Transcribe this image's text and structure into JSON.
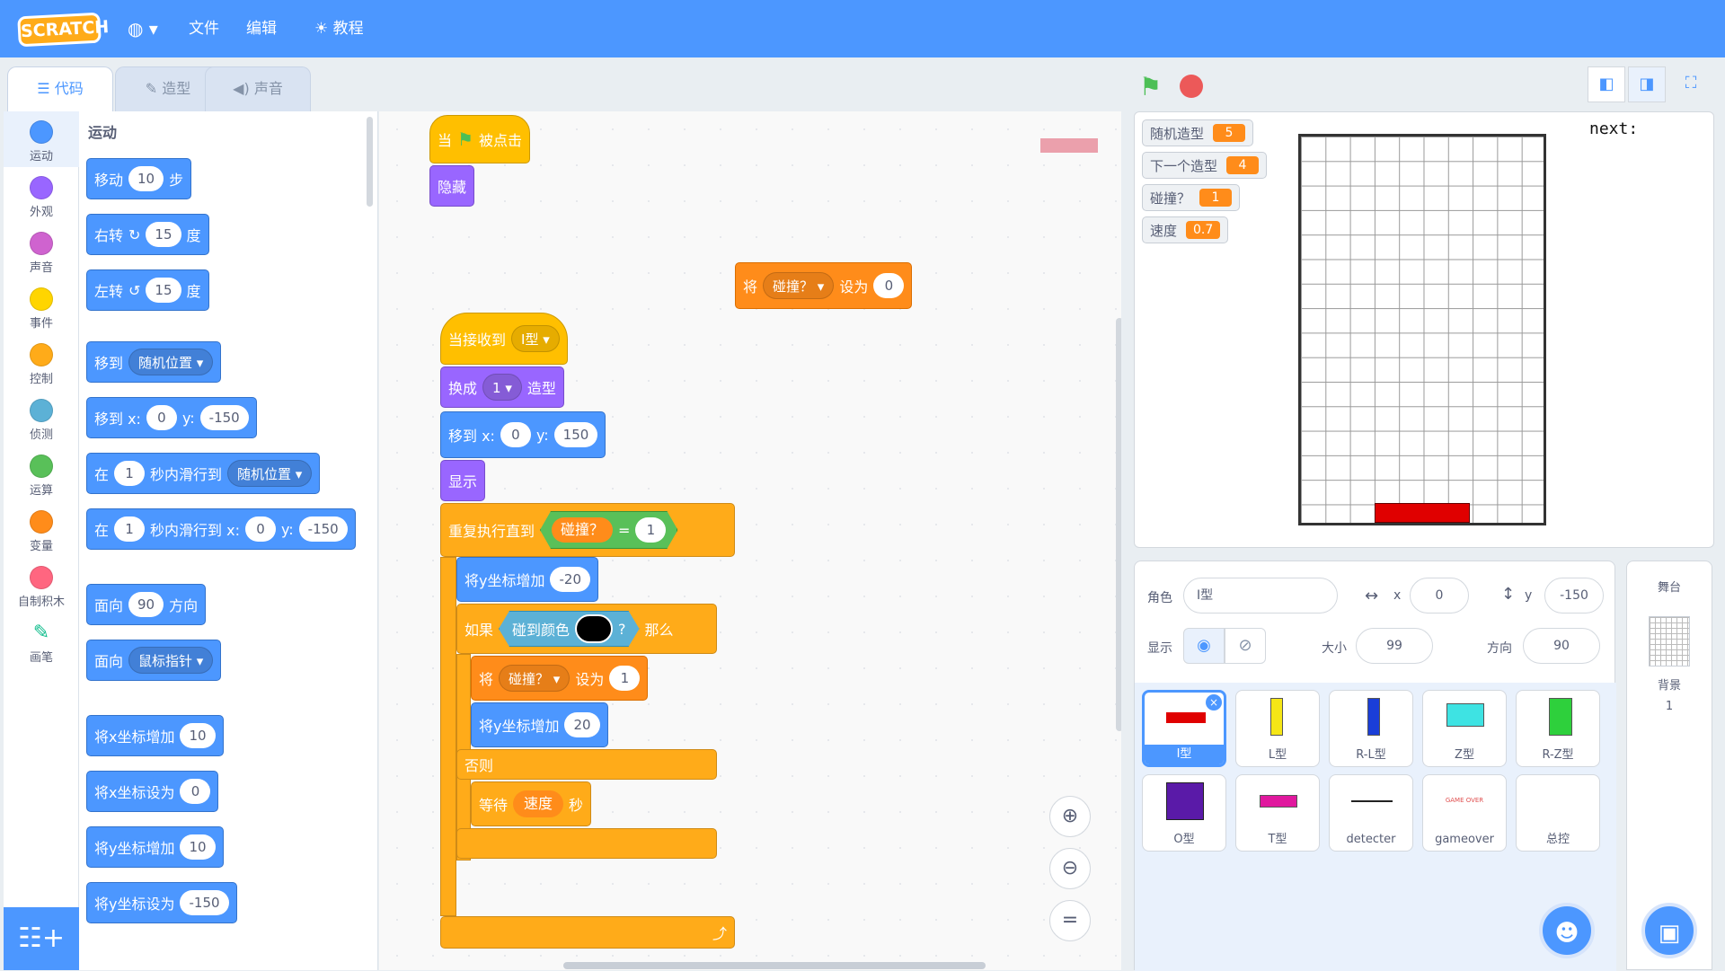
{
  "menu": {
    "logo": "SCRATCH",
    "globe": "◍ ▾",
    "file": "文件",
    "edit": "编辑",
    "tutorials": "教程"
  },
  "tabs": {
    "code": "代码",
    "costumes": "造型",
    "sounds": "声音"
  },
  "categories": [
    {
      "label": "运动",
      "color": "#4c97ff"
    },
    {
      "label": "外观",
      "color": "#9966ff"
    },
    {
      "label": "声音",
      "color": "#cf63cf"
    },
    {
      "label": "事件",
      "color": "#ffd500"
    },
    {
      "label": "控制",
      "color": "#ffab19"
    },
    {
      "label": "侦测",
      "color": "#5cb1d6"
    },
    {
      "label": "运算",
      "color": "#59c059"
    },
    {
      "label": "变量",
      "color": "#ff8c1a"
    },
    {
      "label": "自制积木",
      "color": "#ff6680"
    },
    {
      "label": "画笔",
      "color": "#0fbd8c"
    }
  ],
  "palette": {
    "title": "运动",
    "move": {
      "a": "移动",
      "v": "10",
      "b": "步"
    },
    "turn_right": {
      "a": "右转",
      "icon": "↻",
      "v": "15",
      "b": "度"
    },
    "turn_left": {
      "a": "左转",
      "icon": "↺",
      "v": "15",
      "b": "度"
    },
    "goto": {
      "a": "移到",
      "dd": "随机位置 ▾"
    },
    "goto_xy": {
      "a": "移到 x:",
      "x": "0",
      "b": "y:",
      "y": "-150"
    },
    "glide": {
      "a": "在",
      "v": "1",
      "b": "秒内滑行到",
      "dd": "随机位置 ▾"
    },
    "glide_xy": {
      "a": "在",
      "v": "1",
      "b": "秒内滑行到 x:",
      "x": "0",
      "c": "y:",
      "y": "-150"
    },
    "point_dir": {
      "a": "面向",
      "v": "90",
      "b": "方向"
    },
    "point_towards": {
      "a": "面向",
      "dd": "鼠标指针 ▾"
    },
    "change_x": {
      "a": "将x坐标增加",
      "v": "10"
    },
    "set_x": {
      "a": "将x坐标设为",
      "v": "0"
    },
    "change_y": {
      "a": "将y坐标增加",
      "v": "10"
    },
    "set_y": {
      "a": "将y坐标设为",
      "v": "-150"
    }
  },
  "script1": {
    "when": "当",
    "clicked": "被点击",
    "hide": "隐藏"
  },
  "set_block": {
    "a": "将",
    "var": "碰撞？ ▾",
    "b": "设为",
    "v": "0"
  },
  "script2": {
    "receive": "当接收到",
    "receive_dd": "I型 ▾",
    "switch": "换成",
    "switch_dd": "1 ▾",
    "switch_b": "造型",
    "goto": "移到 x:",
    "goto_x": "0",
    "goto_yl": "y:",
    "goto_y": "150",
    "show": "显示",
    "repeat": "重复执行直到",
    "cond_var": "碰撞？",
    "cond_eq": "=",
    "cond_v": "1",
    "change_y": "将y坐标增加",
    "change_y_v": "-20",
    "if": "如果",
    "touch": "碰到颜色",
    "q": "?",
    "then": "那么",
    "set_a": "将",
    "set_var": "碰撞？ ▾",
    "set_b": "设为",
    "set_v": "1",
    "change_y2": "将y坐标增加",
    "change_y2_v": "20",
    "else": "否则",
    "wait": "等待",
    "wait_var": "速度",
    "wait_b": "秒",
    "loop_icon": "⤴"
  },
  "zoom": {
    "in": "⊕",
    "out": "⊖",
    "reset": "="
  },
  "monitors": [
    {
      "name": "随机造型",
      "value": "5"
    },
    {
      "name": "下一个造型",
      "value": "4"
    },
    {
      "name": "碰撞？",
      "value": "1"
    },
    {
      "name": "速度",
      "value": "0.7"
    }
  ],
  "stage": {
    "next": "next:"
  },
  "sprite_info": {
    "sprite_label": "角色",
    "sprite_name": "I型",
    "x_label": "x",
    "x": "0",
    "y_label": "y",
    "y": "-150",
    "show_label": "显示",
    "size_label": "大小",
    "size": "99",
    "dir_label": "方向",
    "dir": "90"
  },
  "sprites": [
    "I型",
    "L型",
    "R-L型",
    "Z型",
    "R-Z型",
    "O型",
    "T型",
    "detecter",
    "gameover",
    "总控"
  ],
  "stage_panel": {
    "title": "舞台",
    "backdrop_label": "背景",
    "backdrop_count": "1"
  },
  "gameover_thumb": "GAME OVER"
}
